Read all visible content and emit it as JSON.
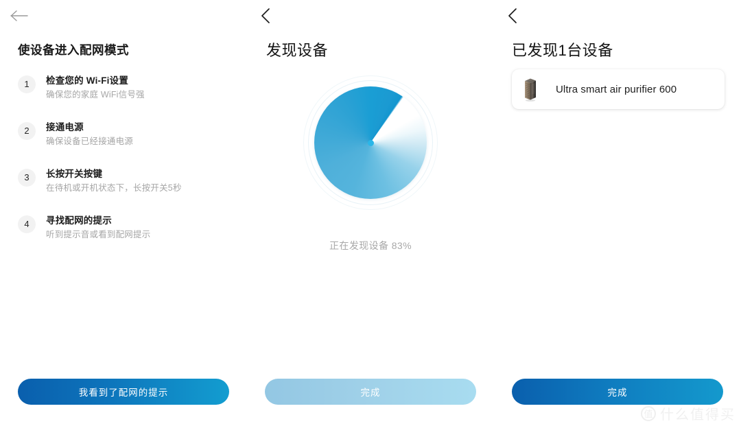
{
  "panels": [
    {
      "id": "setup-instructions",
      "back_icon": "arrow-left-icon",
      "title": "使设备进入配网模式",
      "steps": [
        {
          "num": "1",
          "title": "检查您的 Wi-Fi设置",
          "desc": "确保您的家庭 WiFi信号强"
        },
        {
          "num": "2",
          "title": "接通电源",
          "desc": "确保设备已经接通电源"
        },
        {
          "num": "3",
          "title": "长按开关按键",
          "desc": "在待机或开机状态下，长按开关5秒"
        },
        {
          "num": "4",
          "title": "寻找配网的提示",
          "desc": "听到提示音或看到配网提示"
        }
      ],
      "cta_label": "我看到了配网的提示"
    },
    {
      "id": "discovering",
      "back_icon": "chevron-left-icon",
      "title": "发现设备",
      "progress_percent": 83,
      "progress_label": "正在发现设备 83%",
      "cta_label": "完成",
      "cta_disabled": true
    },
    {
      "id": "devices-found",
      "back_icon": "chevron-left-icon",
      "title": "已发现1台设备",
      "devices": [
        {
          "icon": "air-purifier-icon",
          "name": "Ultra smart air purifier 600"
        }
      ],
      "cta_label": "完成",
      "cta_disabled": false
    }
  ],
  "watermark": {
    "badge": "值",
    "text": "什么值得买"
  },
  "colors": {
    "primary_dark": "#0a5fad",
    "primary_light": "#139dd0",
    "disabled": "#9fd0e8",
    "ring_accent": "#1a9ed4",
    "hub": "#2ab6e8",
    "muted_text": "#a6a6a6"
  }
}
